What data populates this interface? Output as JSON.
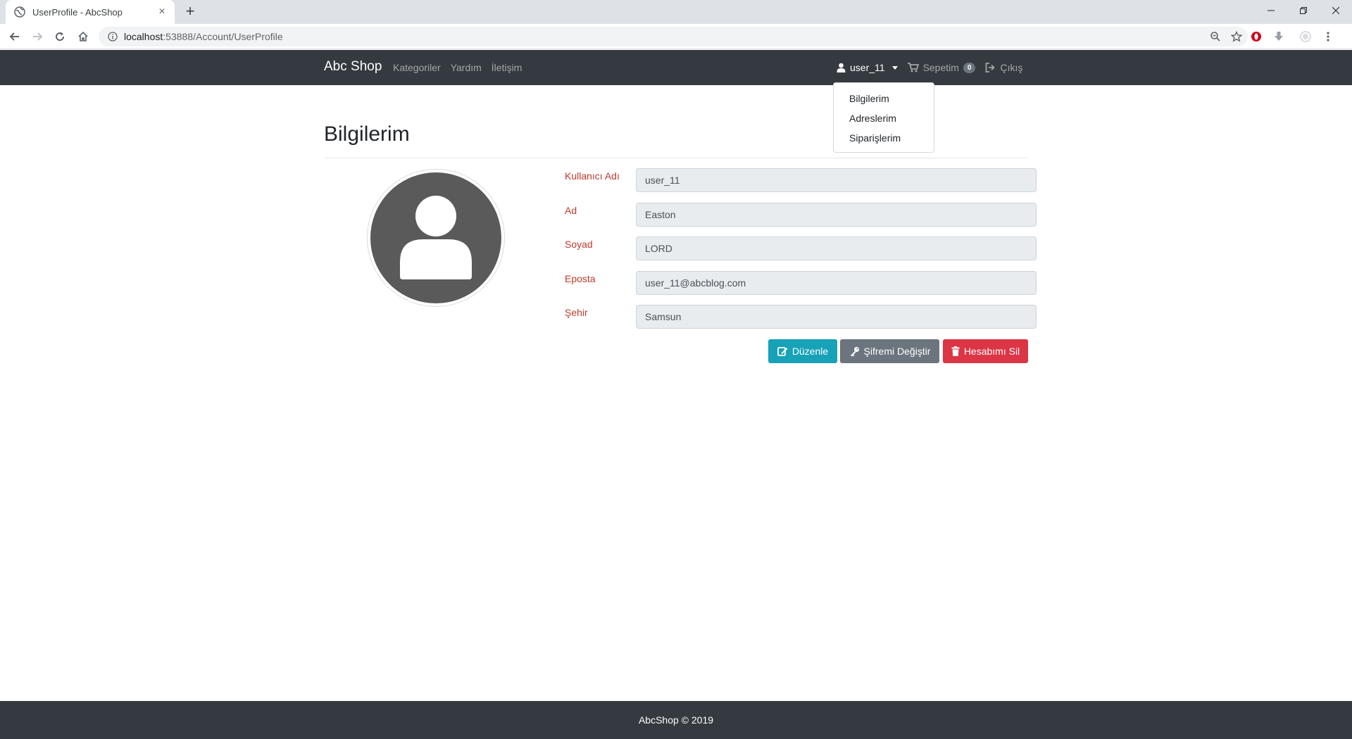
{
  "browser": {
    "tab_title": "UserProfile - AbcShop",
    "url_host": "localhost",
    "url_rest": ":53888/Account/UserProfile"
  },
  "nav": {
    "brand": "Abc Shop",
    "links": [
      "Kategoriler",
      "Yardım",
      "İletişim"
    ],
    "user": "user_11",
    "cart_label": "Sepetim",
    "cart_count": "0",
    "logout": "Çıkış"
  },
  "dropdown": {
    "items": [
      "Bilgilerim",
      "Adreslerim",
      "Siparişlerim"
    ]
  },
  "profile": {
    "title": "Bilgilerim",
    "fields": [
      {
        "label": "Kullanıcı Adı",
        "value": "user_11"
      },
      {
        "label": "Ad",
        "value": "Easton"
      },
      {
        "label": "Soyad",
        "value": "LORD"
      },
      {
        "label": "Eposta",
        "value": "user_11@abcblog.com"
      },
      {
        "label": "Şehir",
        "value": "Samsun"
      }
    ],
    "buttons": {
      "edit": "Düzenle",
      "change_password": "Şifremi Değiştir",
      "delete": "Hesabımı Sil"
    }
  },
  "footer": {
    "text": "AbcShop © 2019"
  },
  "colors": {
    "navbar": "#343a40",
    "label": "#c0392b",
    "btn_edit": "#17a2b8",
    "btn_pass": "#6c757d",
    "btn_delete": "#dc3545"
  }
}
